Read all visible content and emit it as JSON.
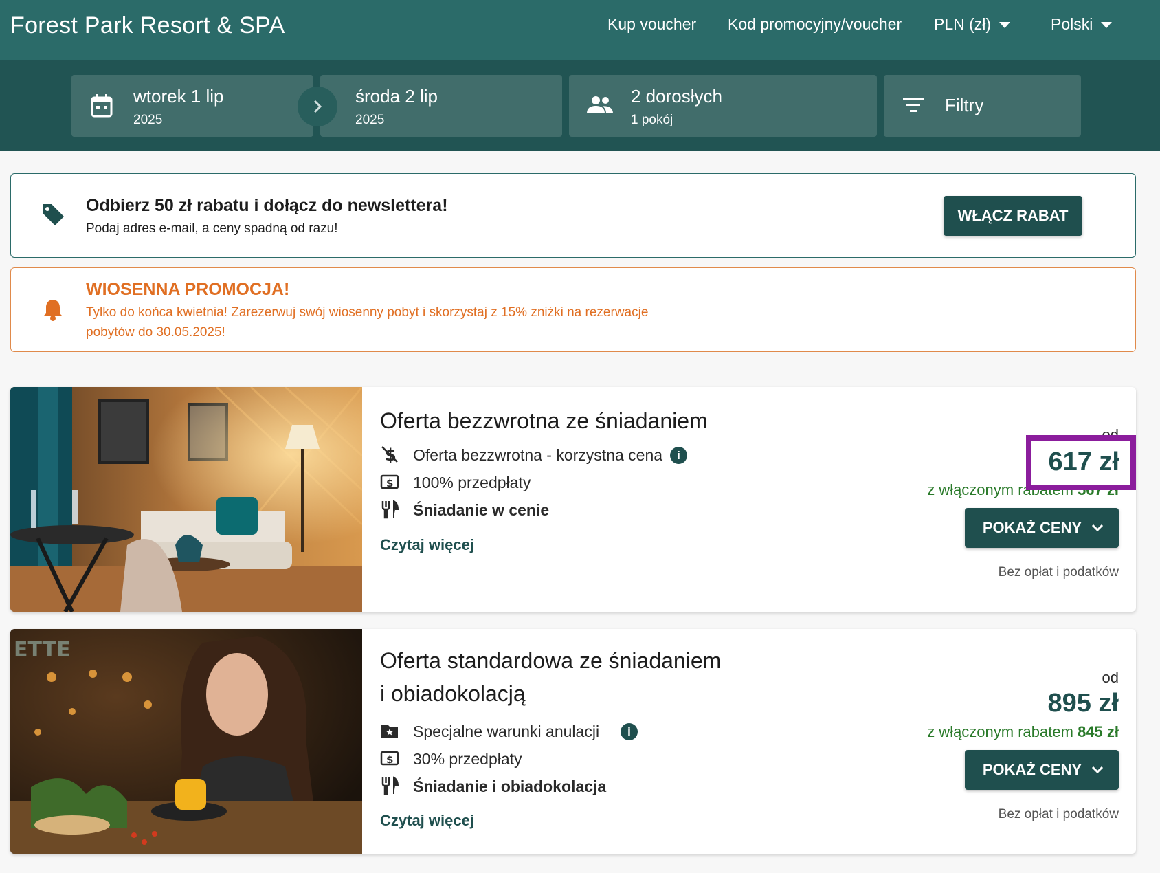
{
  "header": {
    "brand": "Forest Park Resort & SPA",
    "nav": {
      "voucher": "Kup voucher",
      "promo_code": "Kod promocyjny/voucher",
      "currency": "PLN (zł)",
      "language": "Polski"
    }
  },
  "search": {
    "checkin": {
      "day": "wtorek 1 lip",
      "year": "2025"
    },
    "checkout": {
      "day": "środa 2 lip",
      "year": "2025"
    },
    "guests": {
      "adults": "2 dorosłych",
      "rooms": "1 pokój"
    },
    "filters": "Filtry"
  },
  "newsletter": {
    "title": "Odbierz 50 zł rabatu i dołącz do newslettera!",
    "desc": "Podaj adres e-mail, a ceny spadną od razu!",
    "button": "WŁĄCZ RABAT"
  },
  "promo": {
    "title": "WIOSENNA PROMOCJA!",
    "desc": "Tylko do końca kwietnia! Zarezerwuj swój wiosenny pobyt i skorzystaj z 15% zniżki na rezerwacje pobytów do 30.05.2025!"
  },
  "offers": [
    {
      "title": "Oferta bezzwrotna ze śniadaniem",
      "features": [
        "Oferta bezzwrotna - korzystna cena",
        "100% przedpłaty",
        "Śniadanie w cenie"
      ],
      "read_more": "Czytaj więcej",
      "from": "od",
      "price": "617 zł",
      "discount_prefix": "z włączonym rabatem",
      "discount_price": "567 zł",
      "button": "POKAŻ CENY",
      "fees": "Bez opłat i podatków"
    },
    {
      "title_line1": "Oferta standardowa ze śniadaniem",
      "title_line2": "i obiadokolacją",
      "features": [
        "Specjalne warunki anulacji",
        "30% przedpłaty",
        "Śniadanie i obiadokolacja"
      ],
      "read_more": "Czytaj więcej",
      "from": "od",
      "price": "895 zł",
      "discount_prefix": "z włączonym rabatem",
      "discount_price": "845 zł",
      "button": "POKAŻ CENY",
      "fees": "Bez opłat i podatków"
    }
  ],
  "colors": {
    "header_bg": "#2b6b69",
    "search_bg": "#215453",
    "button_bg": "#1f4f4e",
    "promo_orange": "#e06f23",
    "discount_green": "#2a7a2a",
    "highlight_purple": "#8b1d9c"
  },
  "icons": {
    "calendar": "calendar-icon",
    "next": "chevron-right-icon",
    "guests": "people-icon",
    "filters": "filter-icon",
    "tag": "tag-icon",
    "bell": "bell-icon",
    "no_money": "money-off-icon",
    "prepay": "payment-icon",
    "cutlery": "cutlery-icon",
    "star_folder": "folder-star-icon",
    "info": "info-icon",
    "chevron_down": "chevron-down-icon"
  }
}
